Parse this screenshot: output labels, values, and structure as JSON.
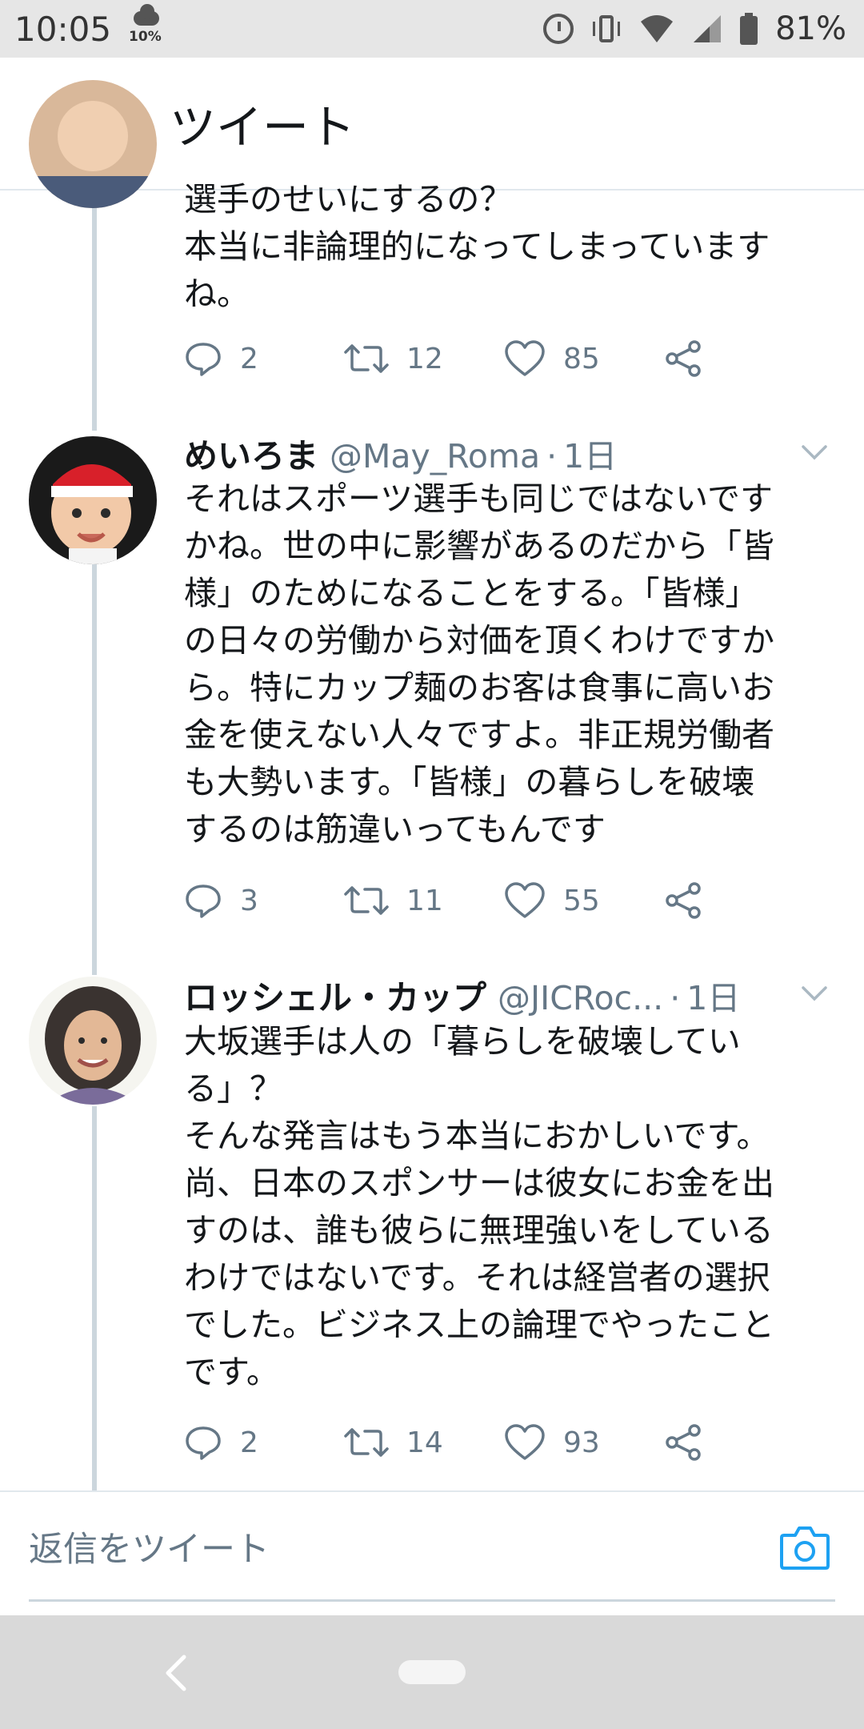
{
  "status_bar": {
    "time": "10:05",
    "weather_percent": "10%",
    "battery_percent": "81%"
  },
  "header": {
    "title": "ツイート"
  },
  "tweets": [
    {
      "text": "選手のせいにするの？\n本当に非論理的になってしまっています\nね。",
      "replies": "2",
      "retweets": "12",
      "likes": "85"
    },
    {
      "name": "めいろま",
      "handle": "@May_Roma",
      "separator": "·",
      "time": "1日",
      "text": "それはスポーツ選手も同じではないです\nかね。世の中に影響があるのだから「皆\n様」のためになることをする。「皆様」\nの日々の労働から対価を頂くわけですか\nら。特にカップ麺のお客は食事に高いお\n金を使えない人々ですよ。非正規労働者\nも大勢います。「皆様」の暮らしを破壊\nするのは筋違いってもんです",
      "replies": "3",
      "retweets": "11",
      "likes": "55"
    },
    {
      "name": "ロッシェル・カップ",
      "handle": "@JICRoc...",
      "separator": "·",
      "time": "1日",
      "text": "大坂選手は人の「暮らしを破壊してい\nる」？\nそんな発言はもう本当におかしいです。\n尚、日本のスポンサーは彼女にお金を出\nすのは、誰も彼らに無理強いをしている\nわけではないです。それは経営者の選択\nでした。ビジネス上の論理でやったこと\nです。",
      "replies": "2",
      "retweets": "14",
      "likes": "93"
    }
  ],
  "reply_bar": {
    "placeholder": "返信をツイート"
  },
  "colors": {
    "accent": "#1da1f2",
    "text_secondary": "#657786",
    "thread_line": "#ccd6dd"
  },
  "icons": [
    "back-arrow-icon",
    "reply-icon",
    "retweet-icon",
    "like-icon",
    "share-icon",
    "caret-down-icon",
    "camera-icon"
  ]
}
